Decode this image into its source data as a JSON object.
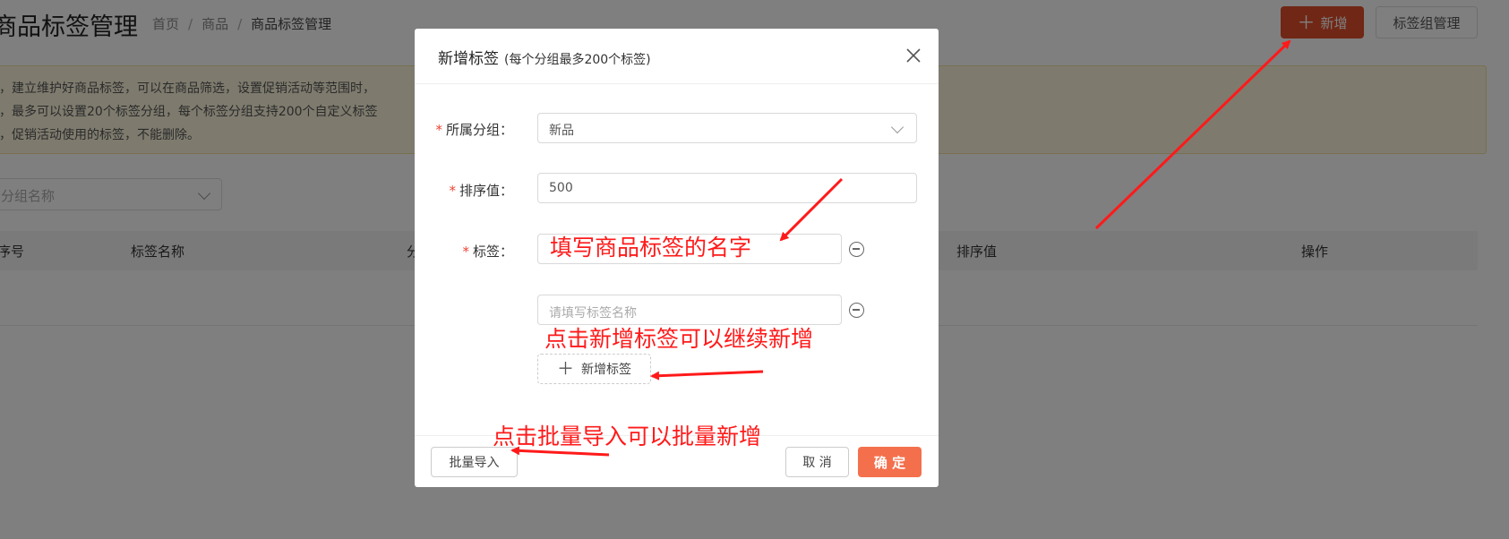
{
  "header": {
    "page_title": "商品标签管理",
    "breadcrumb": [
      "首页",
      "商品",
      "商品标签管理"
    ],
    "add_button": "新增",
    "group_manage_button": "标签组管理"
  },
  "tips": [
    "，建立维护好商品标签，可以在商品筛选，设置促销活动等范围时，",
    "，最多可以设置20个标签分组，每个标签分组支持200个自定义标签",
    "，促销活动使用的标签，不能删除。"
  ],
  "filter": {
    "placeholder": "分组名称"
  },
  "table": {
    "columns": [
      "序号",
      "标签名称",
      "分",
      "排序值",
      "操作"
    ]
  },
  "modal": {
    "title": "新增标签",
    "subtitle": "(每个分组最多200个标签)",
    "group_label": "所属分组：",
    "group_value": "新品",
    "sort_label": "排序值：",
    "sort_value": "500",
    "tag_label": "标签：",
    "tag_placeholder": "请填写标签名称",
    "add_tag_button": "新增标签",
    "import_button": "批量导入",
    "cancel_button": "取 消",
    "ok_button": "确 定"
  },
  "annotations": {
    "tag_name_hint": "填写商品标签的名字",
    "add_tag_hint": "点击新增标签可以继续新增",
    "import_hint": "点击批量导入可以批量新增"
  },
  "colors": {
    "primary": "#e14e2b",
    "ok_button": "#f4704d",
    "annotation": "#ff1a1a",
    "tips_bg": "#fdf6dd"
  }
}
